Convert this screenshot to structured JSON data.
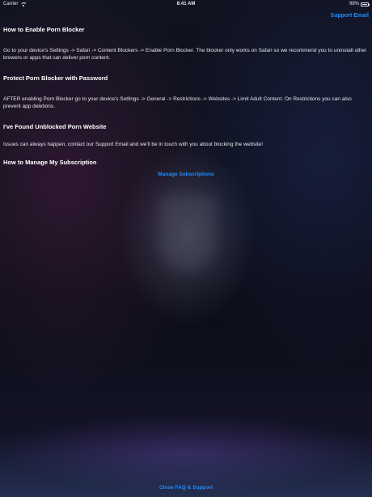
{
  "status_bar": {
    "carrier": "Carrier",
    "time": "8:41 AM",
    "battery": "98%"
  },
  "header": {
    "support_email_label": "Support Email"
  },
  "sections": [
    {
      "title": "How to Enable Porn Blocker",
      "body": "Go to your device's Settings -> Safari -> Content Blockers -> Enable Porn Blocker. The blocker only works on Safari so we recommend you to uninstall other browers or apps that can deliver porn content."
    },
    {
      "title": "Protect Porn Blocker with Password",
      "body": "AFTER enabling Porn Blocker go to your device's Settings -> General -> Restrictions -> Websites -> Limit Adult Content. On Restrictions you can also prevent app deletions."
    },
    {
      "title": "I've Found Unblocked Porn Website",
      "body": "Issues can always happen, contact our Support Email and we'll be in touch with you about blocking the website!"
    },
    {
      "title": "How to Manage My Subscription",
      "link": "Manage Subscriptions"
    }
  ],
  "footer": {
    "close_label": "Close FAQ & Support"
  },
  "colors": {
    "accent": "#1f8fff",
    "background": "#0d0f1a",
    "text": "#ffffff"
  }
}
